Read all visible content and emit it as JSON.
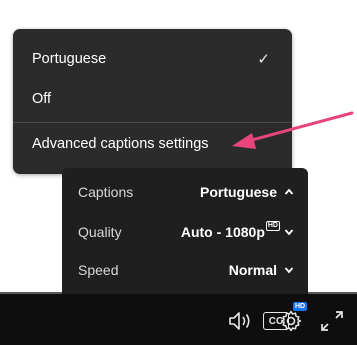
{
  "captions_menu": {
    "items": [
      {
        "label": "Portuguese",
        "checked": true,
        "check_glyph": "✓"
      },
      {
        "label": "Off",
        "checked": false,
        "check_glyph": ""
      }
    ],
    "advanced_label": "Advanced captions settings"
  },
  "settings_panel": {
    "rows": [
      {
        "name": "Captions",
        "value": "Portuguese",
        "chevron": "chevron-up-icon"
      },
      {
        "name": "Quality",
        "value": "Auto - 1080p",
        "badge": "HD",
        "chevron": "chevron-down-icon"
      },
      {
        "name": "Speed",
        "value": "Normal",
        "chevron": "chevron-down-icon"
      }
    ]
  },
  "controls": {
    "cc_label": "CC",
    "settings_badge": "HD",
    "icons": [
      "volume-icon",
      "cc-icon",
      "settings-gear-icon",
      "fullscreen-icon"
    ]
  },
  "annotation": {
    "color": "#e8457a"
  }
}
